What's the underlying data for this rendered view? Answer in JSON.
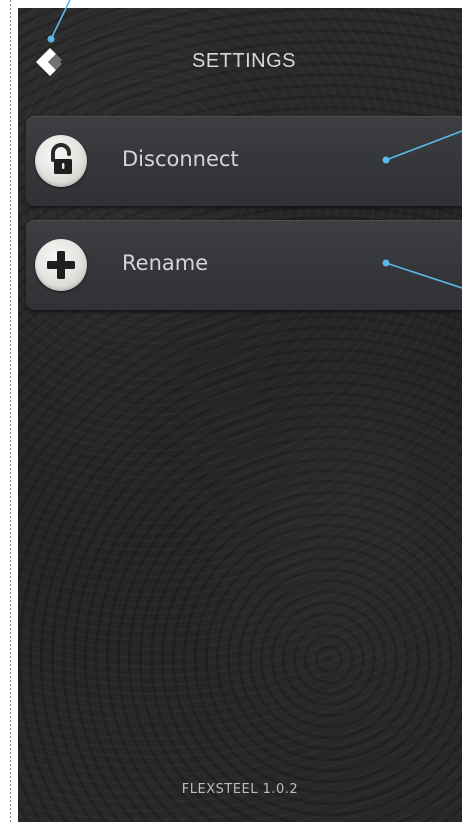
{
  "header": {
    "title": "SETTINGS",
    "back_icon": "chevron-left-icon"
  },
  "menu": {
    "items": [
      {
        "label": "Disconnect",
        "icon": "unlock-icon"
      },
      {
        "label": "Rename",
        "icon": "plus-icon"
      }
    ]
  },
  "footer": {
    "version": "FLEXSTEEL 1.0.2"
  },
  "colors": {
    "background": "#262626",
    "item_background": "#36383c",
    "text": "#d5d5d5",
    "annotation_line": "#5bb8e8"
  }
}
